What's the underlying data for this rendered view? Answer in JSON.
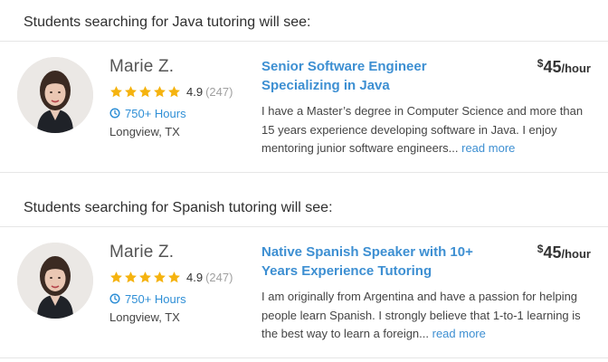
{
  "colors": {
    "accent_blue": "#3d8fd2",
    "star_gold": "#f5b30f",
    "divider": "#e6e6e6"
  },
  "sections": [
    {
      "header": "Students searching for Java tutoring will see:",
      "tutor": {
        "name": "Marie Z.",
        "rating": "4.9",
        "review_count": "(247)",
        "stars": 5,
        "hours": "750+ Hours",
        "hours_icon": "clock-icon",
        "location": "Longview, TX",
        "title": "Senior Software Engineer Specializing in Java",
        "price_currency": "$",
        "price_amount": "45",
        "price_unit": "/hour",
        "description": "I have a Master’s degree in Computer Science and more than 15 years experience developing software in Java. I enjoy mentoring junior software engineers... ",
        "read_more": "read more"
      }
    },
    {
      "header": "Students searching for Spanish tutoring will see:",
      "tutor": {
        "name": "Marie Z.",
        "rating": "4.9",
        "review_count": "(247)",
        "stars": 5,
        "hours": "750+ Hours",
        "hours_icon": "clock-icon",
        "location": "Longview, TX",
        "title": "Native Spanish Speaker with 10+ Years Experience Tutoring",
        "price_currency": "$",
        "price_amount": "45",
        "price_unit": "/hour",
        "description": "I am originally from Argentina and have a passion for helping people learn Spanish. I strongly believe that 1-to-1 learning is the best way to learn a foreign... ",
        "read_more": "read more"
      }
    }
  ]
}
